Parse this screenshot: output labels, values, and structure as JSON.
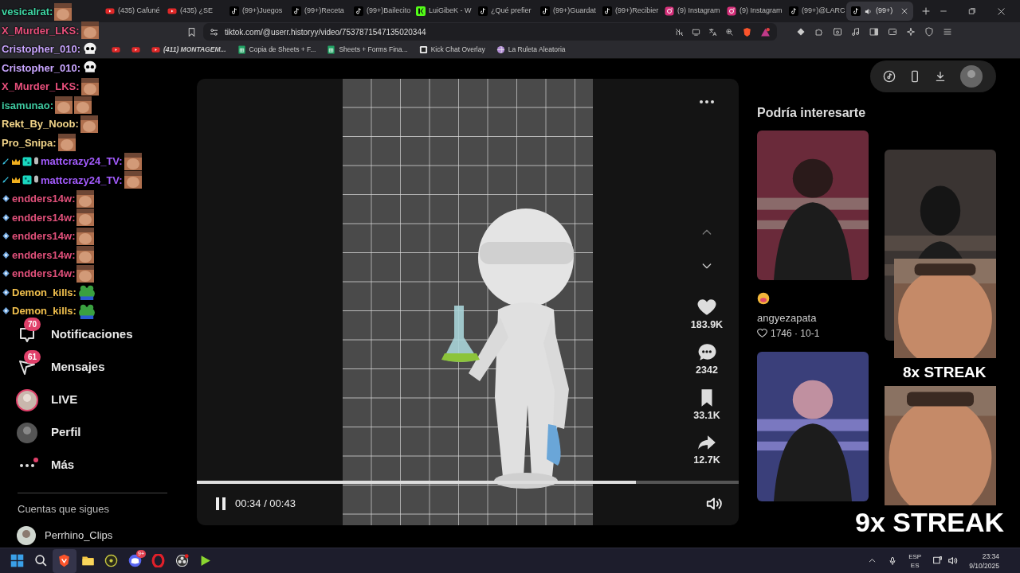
{
  "browser": {
    "tabs": [
      {
        "title": "(435) Cafuné",
        "kind": "youtube",
        "selected": false
      },
      {
        "title": "(435) ¿SE",
        "kind": "youtube",
        "selected": false
      },
      {
        "title": "(99+)Juegos",
        "kind": "tiktok",
        "selected": false
      },
      {
        "title": "(99+)Receta",
        "kind": "tiktok",
        "selected": false
      },
      {
        "title": "(99+)Bailecito",
        "kind": "tiktok",
        "selected": false
      },
      {
        "title": "LuiGibeK - W",
        "kind": "kick",
        "selected": false
      },
      {
        "title": "¿Qué prefier",
        "kind": "tiktok",
        "selected": false
      },
      {
        "title": "(99+)Guardat",
        "kind": "tiktok",
        "selected": false
      },
      {
        "title": "(99+)Recibier",
        "kind": "tiktok",
        "selected": false
      },
      {
        "title": "(9) Instagram",
        "kind": "instagram",
        "selected": false
      },
      {
        "title": "(9) Instagram",
        "kind": "instagram",
        "selected": false
      },
      {
        "title": "(99+)@LARC",
        "kind": "tiktok",
        "selected": false
      },
      {
        "title": "(99+)",
        "kind": "tiktok",
        "selected": true
      }
    ],
    "url": "tiktok.com/@userr.historyy/video/7537871547135020344",
    "bookmarks": [
      {
        "title": "(411) MONTAGEM...",
        "kind": "youtube"
      },
      {
        "title": "Copia de Sheets + F...",
        "kind": "sheets"
      },
      {
        "title": "Sheets + Forms Fina...",
        "kind": "sheets"
      },
      {
        "title": "Kick Chat Overlay",
        "kind": "page"
      },
      {
        "title": "La Ruleta Aleatoria",
        "kind": "globe"
      }
    ]
  },
  "chat_overlay": {
    "messages": [
      {
        "user": "vesicalrat:",
        "color": "#3fd6a4",
        "emotes": [
          {
            "kind": "face"
          }
        ]
      },
      {
        "user": "X_Murder_LKS:",
        "color": "#e8507c",
        "emotes": [
          {
            "kind": "face"
          }
        ]
      },
      {
        "user": "Cristopher_010:",
        "color": "#c9a6ff",
        "emotes": [
          {
            "kind": "skull"
          }
        ]
      },
      {
        "user": "Cristopher_010:",
        "color": "#c9a6ff",
        "emotes": [
          {
            "kind": "skull"
          }
        ]
      },
      {
        "user": "X_Murder_LKS:",
        "color": "#e8507c",
        "emotes": [
          {
            "kind": "face"
          }
        ]
      },
      {
        "user": "isamunao:",
        "color": "#3fc9a0",
        "emotes": [
          {
            "kind": "face"
          },
          {
            "kind": "face"
          }
        ]
      },
      {
        "user": "Rekt_By_Noob:",
        "color": "#f2d58a",
        "emotes": [
          {
            "kind": "face"
          }
        ]
      },
      {
        "user": "Pro_Snipa:",
        "color": "#f2d58a",
        "emotes": [
          {
            "kind": "face"
          }
        ]
      },
      {
        "user": "mattcrazy24_TV:",
        "color": "#a45cff",
        "badges": [
          {
            "kind": "sword"
          },
          {
            "kind": "crown"
          },
          {
            "kind": "tier"
          },
          {
            "kind": "mic"
          }
        ],
        "emotes": [
          {
            "kind": "face"
          }
        ]
      },
      {
        "user": "mattcrazy24_TV:",
        "color": "#a45cff",
        "badges": [
          {
            "kind": "sword"
          },
          {
            "kind": "crown"
          },
          {
            "kind": "tier"
          },
          {
            "kind": "mic"
          }
        ],
        "emotes": [
          {
            "kind": "face"
          }
        ]
      },
      {
        "user": "endders14w:",
        "color": "#e0507a",
        "badges": [
          {
            "kind": "gem"
          }
        ],
        "emotes": [
          {
            "kind": "face"
          }
        ]
      },
      {
        "user": "endders14w:",
        "color": "#e0507a",
        "badges": [
          {
            "kind": "gem"
          }
        ],
        "emotes": [
          {
            "kind": "face"
          }
        ]
      },
      {
        "user": "endders14w:",
        "color": "#e0507a",
        "badges": [
          {
            "kind": "gem"
          }
        ],
        "emotes": [
          {
            "kind": "face"
          }
        ]
      },
      {
        "user": "endders14w:",
        "color": "#e0507a",
        "badges": [
          {
            "kind": "gem"
          }
        ],
        "emotes": [
          {
            "kind": "face"
          }
        ]
      },
      {
        "user": "endders14w:",
        "color": "#e0507a",
        "badges": [
          {
            "kind": "gem"
          }
        ],
        "emotes": [
          {
            "kind": "face"
          }
        ]
      },
      {
        "user": "Demon_kills:",
        "color": "#f2c14e",
        "badges": [
          {
            "kind": "gem"
          }
        ],
        "emotes": [
          {
            "kind": "frog"
          }
        ]
      },
      {
        "user": "Demon_kills:",
        "color": "#f2c14e",
        "badges": [
          {
            "kind": "gem"
          }
        ],
        "emotes": [
          {
            "kind": "frog"
          }
        ]
      }
    ]
  },
  "sidebar": {
    "items": [
      {
        "label": "Notificaciones",
        "kind": "inbox",
        "badge": "70"
      },
      {
        "label": "Mensajes",
        "kind": "send",
        "badge": "61"
      },
      {
        "label": "LIVE",
        "kind": "live-avatar"
      },
      {
        "label": "Perfil",
        "kind": "avatar"
      },
      {
        "label": "Más",
        "kind": "more",
        "dot": true
      }
    ],
    "section_title": "Cuentas que sigues",
    "following": [
      {
        "name": "Perrhino_Clips"
      }
    ]
  },
  "video": {
    "playing": true,
    "progress": {
      "level": 0.81
    },
    "time": "00:34 / 00:43",
    "actions": [
      {
        "kind": "heart",
        "count": "183.9K"
      },
      {
        "kind": "comment",
        "count": "2342"
      },
      {
        "kind": "bookmark",
        "count": "33.1K"
      },
      {
        "kind": "share",
        "count": "12.7K"
      }
    ]
  },
  "suggestions": {
    "title": "Podría interesarte",
    "cards": [
      {
        "kind": "picture",
        "author": "angyezapata",
        "stats": "1746 · 10-1"
      },
      {
        "kind": "picture"
      },
      {
        "kind": "picture"
      }
    ]
  },
  "streak_overlays": [
    {
      "text": "8x STREAK"
    },
    {
      "text": "9x STREAK"
    }
  ],
  "taskbar": {
    "apps": [
      {
        "kind": "windows",
        "active": false
      },
      {
        "kind": "search",
        "active": false
      },
      {
        "kind": "brave",
        "active": true
      },
      {
        "kind": "folder",
        "active": false
      },
      {
        "kind": "disc",
        "active": false
      },
      {
        "kind": "discord",
        "active": false,
        "badge": "9+"
      },
      {
        "kind": "opera",
        "active": false
      },
      {
        "kind": "obs",
        "active": false
      },
      {
        "kind": "play",
        "active": false
      }
    ],
    "language": [
      "ESP",
      "ES"
    ],
    "time": "23:34",
    "date": "9/10/2025"
  }
}
